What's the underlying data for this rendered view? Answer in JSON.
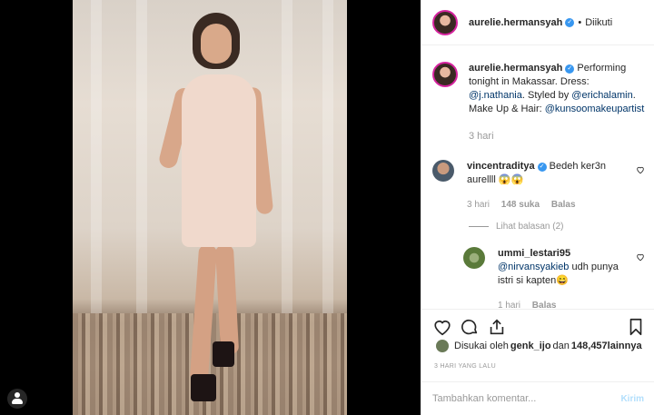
{
  "post": {
    "username": "aurelie.hermansyah",
    "follow_status": "Diikuti",
    "separator": "•"
  },
  "caption": {
    "username": "aurelie.hermansyah",
    "text_1": " Performing tonight in Makassar. Dress: ",
    "mention_1": "@j.nathania",
    "text_2": ". Styled by ",
    "mention_2": "@erichalamin",
    "text_3": ". Make Up & Hair: ",
    "mention_3": "@kunsoomakeupartist",
    "time": "3 hari"
  },
  "comments": [
    {
      "username": "vincentraditya",
      "text": "Bedeh ker3n aurellll 😱😱",
      "time": "3 hari",
      "likes": "148 suka",
      "reply": "Balas"
    }
  ],
  "view_replies": "Lihat balasan (2)",
  "replies": [
    {
      "username": "ummi_lestari95",
      "mention": "@nirvansyakieb",
      "text": " udh punya istri si kapten😄",
      "time": "1 hari",
      "reply": "Balas"
    }
  ],
  "likes": {
    "prefix": "Disukai oleh ",
    "user": "genk_ijo",
    "middle": " dan ",
    "count": "148,457",
    "suffix": " lainnya"
  },
  "posted_time": "3 HARI YANG LALU",
  "comment_input": {
    "placeholder": "Tambahkan komentar...",
    "post_label": "Kirim"
  },
  "colors": {
    "accent": "#3897f0",
    "mention": "#003569",
    "muted": "#999999",
    "post_disabled": "#b2dffc"
  }
}
